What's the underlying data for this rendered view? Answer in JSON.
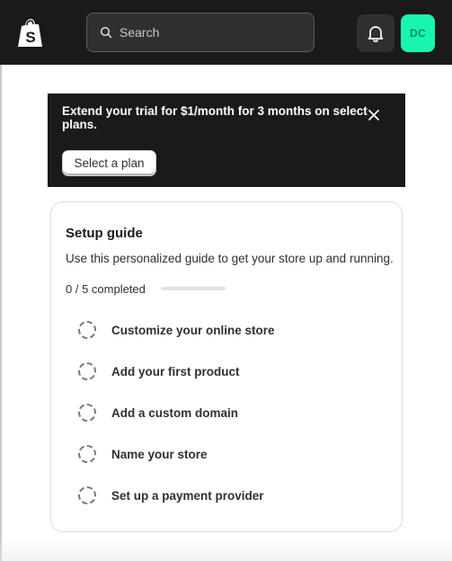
{
  "topbar": {
    "logo": "shopify-bag-logo",
    "search_placeholder": "Search",
    "notifications_icon": "bell-icon",
    "avatar_initials": "DC",
    "avatar_color": "#18f5b0"
  },
  "banner": {
    "message": "Extend your trial for $1/month for 3 months on select plans.",
    "button_label": "Select a plan",
    "close_icon": "close-icon"
  },
  "setup_guide": {
    "title": "Setup guide",
    "description": "Use this personalized guide to get your store up and running.",
    "progress_text": "0 / 5 completed",
    "progress_fraction": 0,
    "steps": [
      {
        "label": "Customize your online store",
        "completed": false
      },
      {
        "label": "Add your first product",
        "completed": false
      },
      {
        "label": "Add a custom domain",
        "completed": false
      },
      {
        "label": "Name your store",
        "completed": false
      },
      {
        "label": "Set up a payment provider",
        "completed": false
      }
    ]
  }
}
